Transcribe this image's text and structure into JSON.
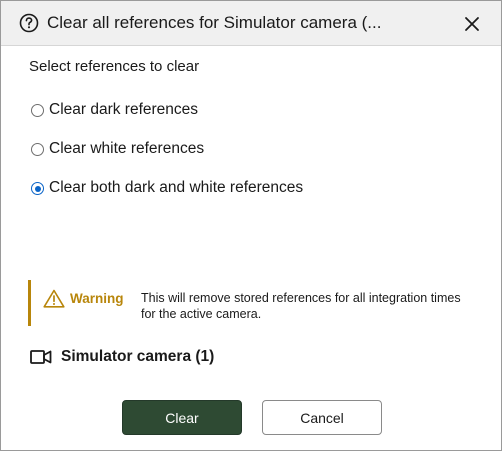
{
  "dialog": {
    "title": "Clear all references for Simulator camera (...",
    "help_icon": "question-circle-icon",
    "close_icon": "close-icon"
  },
  "prompt": "Select references to clear",
  "options": [
    {
      "label": "Clear dark references",
      "selected": false
    },
    {
      "label": "Clear white references",
      "selected": false
    },
    {
      "label": "Clear both dark and white references",
      "selected": true
    }
  ],
  "warning": {
    "icon": "warning-triangle-icon",
    "title": "Warning",
    "text": "This will remove stored references for all integration times for the active camera.",
    "color": "#b8860b"
  },
  "camera": {
    "icon": "video-camera-icon",
    "label": "Simulator camera (1)"
  },
  "buttons": {
    "clear_label": "Clear",
    "cancel_label": "Cancel",
    "primary_color": "#2e4a33"
  },
  "colors": {
    "radio_selected": "#0a64c8"
  }
}
